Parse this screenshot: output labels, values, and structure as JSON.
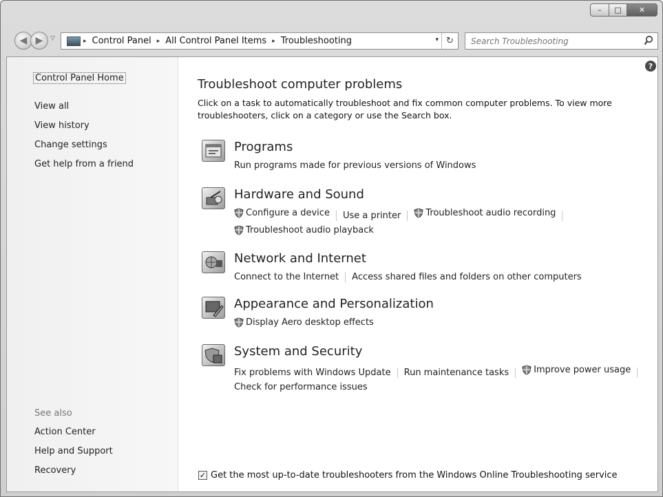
{
  "window": {
    "caption_minimize": "–",
    "caption_maximize": "□",
    "caption_close": "✕"
  },
  "nav": {
    "back_icon": "◀",
    "forward_icon": "▶",
    "history_dropdown": "▽"
  },
  "address": {
    "breadcrumbs": [
      "Control Panel",
      "All Control Panel Items",
      "Troubleshooting"
    ],
    "separator": "▸",
    "dropdown": "▾",
    "refresh": "↻"
  },
  "search": {
    "placeholder": "Search Troubleshooting"
  },
  "sidebar": {
    "home": "Control Panel Home",
    "links": [
      "View all",
      "View history",
      "Change settings",
      "Get help from a friend"
    ],
    "see_also_label": "See also",
    "see_also": [
      "Action Center",
      "Help and Support",
      "Recovery"
    ]
  },
  "main": {
    "help_icon": "?",
    "title": "Troubleshoot computer problems",
    "description": "Click on a task to automatically troubleshoot and fix common computer problems. To view more troubleshooters, click on a category or use the Search box.",
    "categories": [
      {
        "title": "Programs",
        "icon": "programs-icon",
        "links": [
          {
            "label": "Run programs made for previous versions of Windows",
            "shield": false
          }
        ]
      },
      {
        "title": "Hardware and Sound",
        "icon": "hardware-sound-icon",
        "links": [
          {
            "label": "Configure a device",
            "shield": true
          },
          {
            "label": "Use a printer",
            "shield": false
          },
          {
            "label": "Troubleshoot audio recording",
            "shield": true
          },
          {
            "label": "Troubleshoot audio playback",
            "shield": true
          }
        ]
      },
      {
        "title": "Network and Internet",
        "icon": "network-internet-icon",
        "links": [
          {
            "label": "Connect to the Internet",
            "shield": false
          },
          {
            "label": "Access shared files and folders on other computers",
            "shield": false
          }
        ]
      },
      {
        "title": "Appearance and Personalization",
        "icon": "appearance-icon",
        "links": [
          {
            "label": "Display Aero desktop effects",
            "shield": true
          }
        ]
      },
      {
        "title": "System and Security",
        "icon": "system-security-icon",
        "links": [
          {
            "label": "Fix problems with Windows Update",
            "shield": false
          },
          {
            "label": "Run maintenance tasks",
            "shield": false
          },
          {
            "label": "Improve power usage",
            "shield": true
          },
          {
            "label": "Check for performance issues",
            "shield": false
          }
        ]
      }
    ],
    "online_checkbox": {
      "label": "Get the most up-to-date troubleshooters from the Windows Online Troubleshooting service",
      "checked": true,
      "check_glyph": "✓"
    }
  }
}
